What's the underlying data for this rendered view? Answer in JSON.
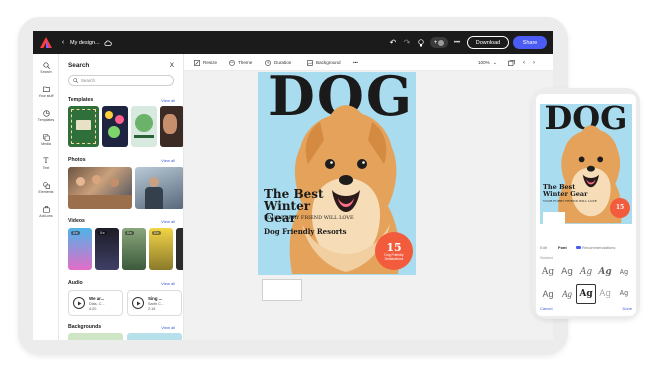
{
  "topbar": {
    "doc_title": "My design...",
    "zoom_label": "100%",
    "download_label": "Download",
    "share_label": "Share"
  },
  "rail": {
    "items": [
      {
        "label": "Search",
        "icon": "search-icon"
      },
      {
        "label": "Your stuff",
        "icon": "folder-icon"
      },
      {
        "label": "Templates",
        "icon": "templates-icon"
      },
      {
        "label": "Media",
        "icon": "media-icon"
      },
      {
        "label": "Text",
        "icon": "text-icon"
      },
      {
        "label": "Elements",
        "icon": "elements-icon"
      },
      {
        "label": "Add-ons",
        "icon": "addons-icon"
      }
    ]
  },
  "panel": {
    "title": "Search",
    "close": "X",
    "search_placeholder": "Search",
    "view_all": "View all",
    "sections": {
      "templates": "Templates",
      "photos": "Photos",
      "videos": "Videos",
      "audio": "Audio",
      "backgrounds": "Backgrounds"
    },
    "videos": [
      {
        "duration": "0:x"
      },
      {
        "duration": "0:x"
      },
      {
        "duration": "0:x"
      },
      {
        "duration": "0:x"
      }
    ],
    "audio": [
      {
        "title": "We ar...",
        "artist": "Dias, C...",
        "length": "4:20"
      },
      {
        "title": "Sing ...",
        "artist": "Sarth C...",
        "length": "2:15"
      }
    ]
  },
  "toolbar": {
    "resize": "Resize",
    "theme": "Theme",
    "duration": "Duration",
    "background": "Background",
    "more": "•••"
  },
  "cover": {
    "masthead": "DOG",
    "headline": "The Best Winter Gear",
    "subline": "YOUR FURRY FRIEND WILL LOVE",
    "resorts": "Dog Friendly Resorts",
    "badge_num": "15",
    "badge_text": "Dog Friendly Destinations"
  },
  "phone": {
    "tabs": [
      "Edit",
      "Font",
      "Recommendations"
    ],
    "section_label": "Standard",
    "fonts_row1": [
      "Ag",
      "Ag",
      "Ag",
      "Ag",
      "Ag"
    ],
    "fonts_row2": [
      "Ag",
      "Ag",
      "Ag",
      "Ag",
      "Ag"
    ],
    "cancel": "Cancel",
    "done": "Done"
  },
  "colors": {
    "accent": "#4b5cf5",
    "topbar": "#1b1b1b",
    "cover_bg": "#a9dcef",
    "badge": "#f25b3c"
  }
}
